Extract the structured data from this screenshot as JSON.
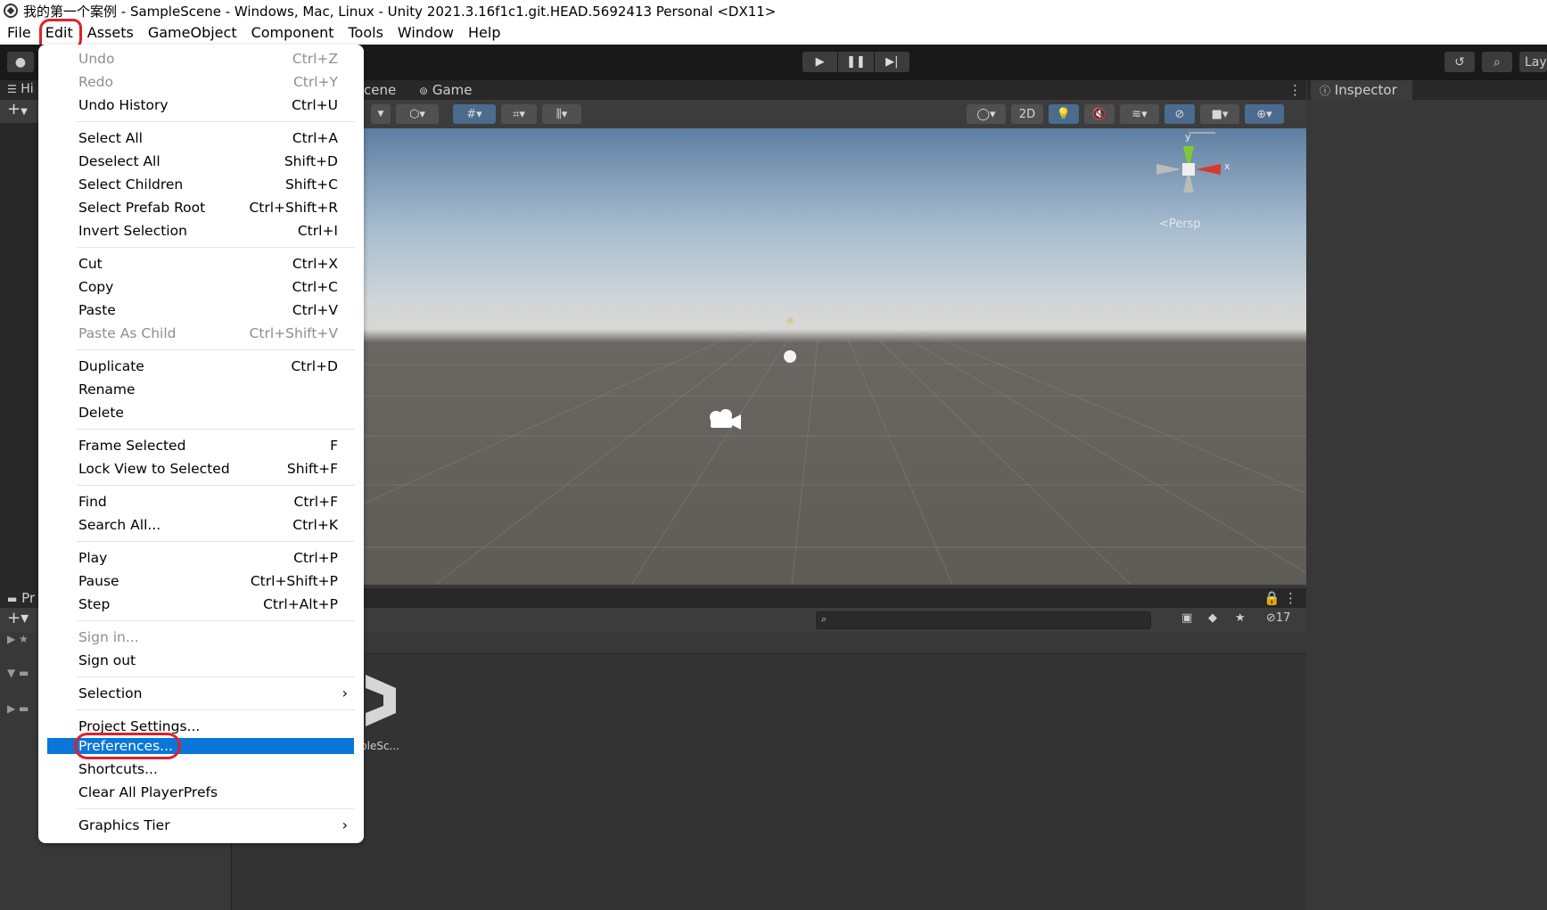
{
  "window": {
    "title": "我的第一个案例 - SampleScene - Windows, Mac, Linux - Unity 2021.3.16f1c1.git.HEAD.5692413 Personal <DX11>"
  },
  "menubar": {
    "items": [
      "File",
      "Edit",
      "Assets",
      "GameObject",
      "Component",
      "Tools",
      "Window",
      "Help"
    ],
    "active": "Edit"
  },
  "toolbar": {
    "layers_label": "Lay"
  },
  "hierarchy": {
    "tab_label": "Hi"
  },
  "scene_view": {
    "tabs": [
      "cene",
      "Game"
    ],
    "mode_2d": "2D",
    "persp_label": "<Persp",
    "gizmo_axes": {
      "y": "y",
      "x": "x"
    }
  },
  "inspector": {
    "tab_label": "Inspector"
  },
  "project": {
    "tab_label": "Pr",
    "hidden_count": "17",
    "asset_label": "pleSc..."
  },
  "edit_menu": {
    "items": [
      {
        "label": "Undo",
        "shortcut": "Ctrl+Z",
        "disabled": true
      },
      {
        "label": "Redo",
        "shortcut": "Ctrl+Y",
        "disabled": true
      },
      {
        "label": "Undo History",
        "shortcut": "Ctrl+U"
      },
      {
        "label": "Select All",
        "shortcut": "Ctrl+A"
      },
      {
        "label": "Deselect All",
        "shortcut": "Shift+D"
      },
      {
        "label": "Select Children",
        "shortcut": "Shift+C"
      },
      {
        "label": "Select Prefab Root",
        "shortcut": "Ctrl+Shift+R"
      },
      {
        "label": "Invert Selection",
        "shortcut": "Ctrl+I"
      },
      {
        "label": "Cut",
        "shortcut": "Ctrl+X"
      },
      {
        "label": "Copy",
        "shortcut": "Ctrl+C"
      },
      {
        "label": "Paste",
        "shortcut": "Ctrl+V"
      },
      {
        "label": "Paste As Child",
        "shortcut": "Ctrl+Shift+V",
        "disabled": true
      },
      {
        "label": "Duplicate",
        "shortcut": "Ctrl+D"
      },
      {
        "label": "Rename",
        "shortcut": ""
      },
      {
        "label": "Delete",
        "shortcut": ""
      },
      {
        "label": "Frame Selected",
        "shortcut": "F"
      },
      {
        "label": "Lock View to Selected",
        "shortcut": "Shift+F"
      },
      {
        "label": "Find",
        "shortcut": "Ctrl+F"
      },
      {
        "label": "Search All...",
        "shortcut": "Ctrl+K"
      },
      {
        "label": "Play",
        "shortcut": "Ctrl+P"
      },
      {
        "label": "Pause",
        "shortcut": "Ctrl+Shift+P"
      },
      {
        "label": "Step",
        "shortcut": "Ctrl+Alt+P"
      },
      {
        "label": "Sign in...",
        "shortcut": "",
        "disabled": true
      },
      {
        "label": "Sign out",
        "shortcut": ""
      },
      {
        "label": "Selection",
        "shortcut": "",
        "submenu": true
      },
      {
        "label": "Project Settings...",
        "shortcut": ""
      },
      {
        "label": "Preferences...",
        "shortcut": "",
        "highlighted": true
      },
      {
        "label": "Shortcuts...",
        "shortcut": ""
      },
      {
        "label": "Clear All PlayerPrefs",
        "shortcut": ""
      },
      {
        "label": "Graphics Tier",
        "shortcut": "",
        "submenu": true
      }
    ]
  },
  "colors": {
    "menu_highlight": "#0a76d8",
    "annotation_red": "#e0202a",
    "editor_bg": "#383838"
  }
}
